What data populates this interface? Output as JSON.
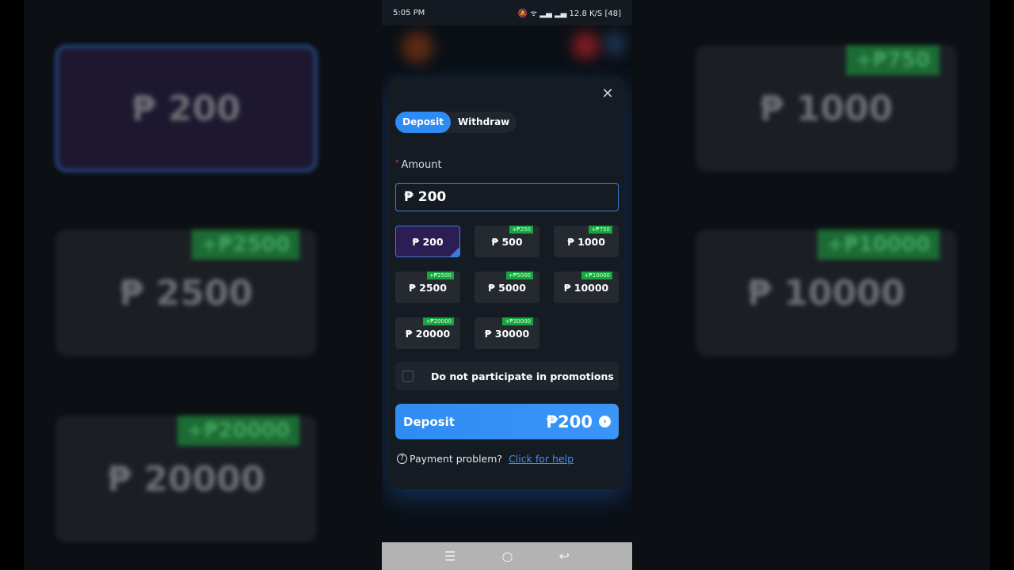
{
  "status": {
    "time": "5:05 PM",
    "speed": "12.8 K/S",
    "battery": "48"
  },
  "modal": {
    "close_icon": "close-icon",
    "tabs": [
      {
        "label": "Deposit",
        "active": true
      },
      {
        "label": "Withdraw",
        "active": false
      }
    ],
    "amount_label": "Amount",
    "currency": "₱",
    "amount_value": "200",
    "options": [
      {
        "amount": "₱ 200",
        "bonus": null,
        "selected": true
      },
      {
        "amount": "₱ 500",
        "bonus": "+₱250"
      },
      {
        "amount": "₱ 1000",
        "bonus": "+₱750"
      },
      {
        "amount": "₱ 2500",
        "bonus": "+₱2500"
      },
      {
        "amount": "₱ 5000",
        "bonus": "+₱5000"
      },
      {
        "amount": "₱ 10000",
        "bonus": "+₱10000"
      },
      {
        "amount": "₱ 20000",
        "bonus": "+₱20000"
      },
      {
        "amount": "₱ 30000",
        "bonus": "+₱30000"
      }
    ],
    "promo_label": "Do not participate in promotions",
    "promo_checked": false,
    "deposit_label": "Deposit",
    "deposit_amount": "₱200",
    "help_text": "Payment problem?",
    "help_link": "Click for help"
  },
  "colors": {
    "accent": "#2e8bf3",
    "bonus": "#17a540",
    "selected_bg": "#2a1e54"
  }
}
